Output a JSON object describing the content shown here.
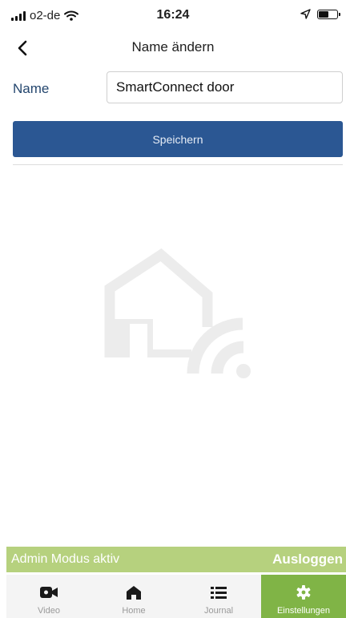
{
  "status_bar": {
    "carrier": "o2-de",
    "time": "16:24",
    "icons": [
      "signal-icon",
      "wifi-icon",
      "location-icon",
      "battery-icon"
    ]
  },
  "nav": {
    "title": "Name ändern",
    "back_icon": "chevron-left-icon"
  },
  "form": {
    "name_label": "Name",
    "name_value": "SmartConnect door",
    "save_label": "Speichern"
  },
  "illustration": {
    "icon": "house-wifi-icon",
    "color": "#ececec"
  },
  "admin_bar": {
    "text": "Admin Modus aktiv",
    "logout_label": "Ausloggen",
    "color": "#b6d17e"
  },
  "tabs": [
    {
      "label": "Video",
      "icon": "video-camera-icon",
      "active": false
    },
    {
      "label": "Home",
      "icon": "home-icon",
      "active": false
    },
    {
      "label": "Journal",
      "icon": "list-icon",
      "active": false
    },
    {
      "label": "Einstellungen",
      "icon": "gear-icon",
      "active": true
    }
  ],
  "colors": {
    "primary": "#2b5793",
    "active_tab": "#80b446",
    "label": "#24466e"
  }
}
